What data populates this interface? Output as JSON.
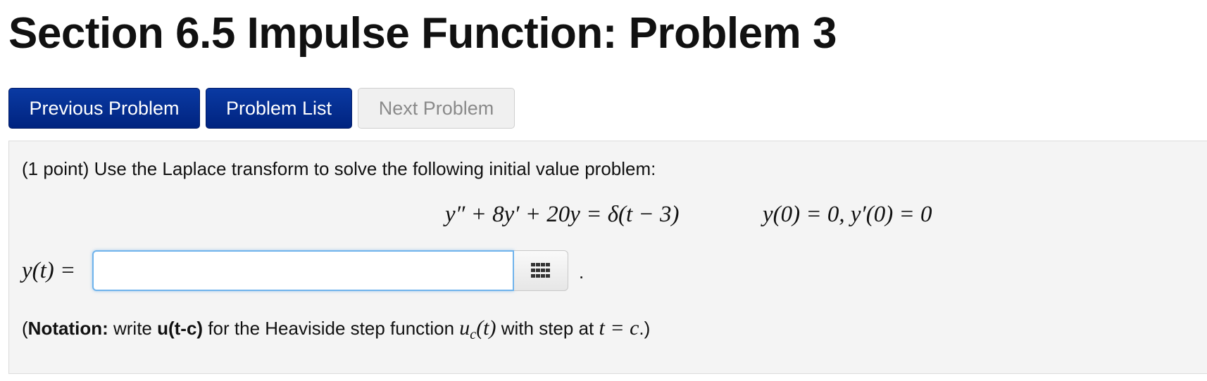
{
  "page": {
    "title": "Section 6.5 Impulse Function: Problem 3"
  },
  "nav": {
    "previous_label": "Previous Problem",
    "list_label": "Problem List",
    "next_label": "Next Problem"
  },
  "problem": {
    "prompt": "(1 point) Use the Laplace transform to solve the following initial value problem:",
    "equation": "y″ + 8y′ + 20y = δ(t − 3)",
    "initial_conditions": "y(0) = 0,  y′(0) = 0",
    "answer_label": "y(t) =",
    "answer_value": "",
    "answer_placeholder": "",
    "keypad_icon": "keypad-icon",
    "trailing_period": "."
  },
  "notation": {
    "open_paren": "(",
    "bold_label": "Notation:",
    "text1": " write ",
    "code": "u(t-c)",
    "text2": " for the Heaviside step function ",
    "func": "u",
    "func_sub": "c",
    "func_arg": "(t)",
    "text3": " with step at ",
    "expr": "t = c",
    "close": ".)"
  },
  "colors": {
    "primary_button": "#00237f",
    "disabled_button_text": "#8a8a8a",
    "input_focus_border": "#6fb3ec",
    "panel_background": "#f4f4f4"
  }
}
